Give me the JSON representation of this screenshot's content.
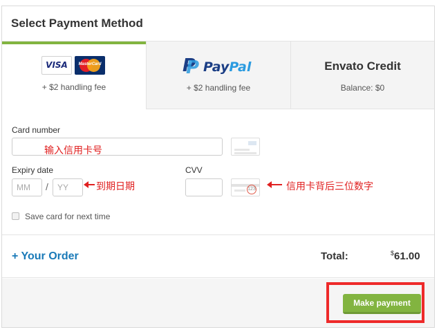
{
  "header": {
    "title": "Select Payment Method"
  },
  "tabs": [
    {
      "name": "cards",
      "logos": [
        "VISA",
        "MasterCard"
      ],
      "subtext": "+ $2 handling fee",
      "active": true
    },
    {
      "name": "paypal",
      "logo_text_pay": "Pay",
      "logo_text_pal": "Pal",
      "icon_text": "P",
      "subtext": "+ $2 handling fee",
      "active": false
    },
    {
      "name": "envato",
      "title": "Envato Credit",
      "subtext": "Balance: $0",
      "active": false
    }
  ],
  "form": {
    "card_number_label": "Card number",
    "expiry_label": "Expiry date",
    "expiry_month_placeholder": "MM",
    "expiry_year_placeholder": "YY",
    "expiry_separator": "/",
    "cvv_label": "CVV",
    "cvv_icon_text": "123",
    "save_card_label": "Save card for next time",
    "save_card_checked": false
  },
  "annotations": {
    "card_number": "输入信用卡号",
    "expiry": "到期日期",
    "cvv": "信用卡背后三位数字"
  },
  "order": {
    "toggle_label": "+ Your Order",
    "total_label": "Total:",
    "currency_symbol": "$",
    "total_amount": "61.00"
  },
  "footer": {
    "make_payment_label": "Make payment"
  },
  "colors": {
    "accent": "#82b440",
    "link": "#1a7ab8",
    "annotation": "#e02020",
    "highlight": "#ee2a2a"
  }
}
